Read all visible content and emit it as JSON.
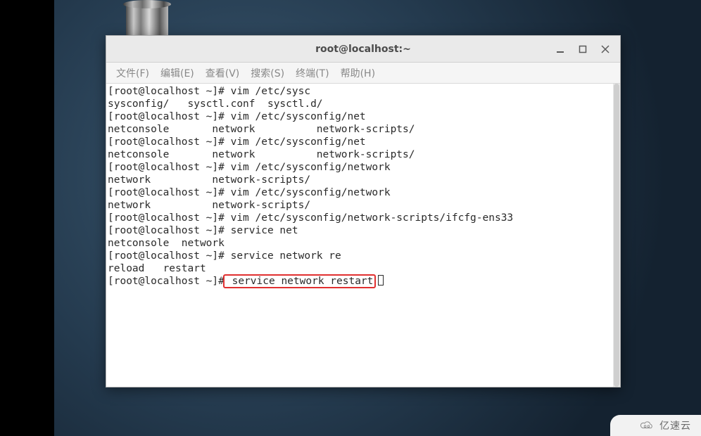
{
  "desktop": {
    "trash_label": "Trash"
  },
  "window": {
    "title": "root@localhost:~"
  },
  "menubar": {
    "items": [
      "文件(F)",
      "编辑(E)",
      "查看(V)",
      "搜索(S)",
      "终端(T)",
      "帮助(H)"
    ]
  },
  "terminal": {
    "lines": [
      "[root@localhost ~]# vim /etc/sysc",
      "sysconfig/   sysctl.conf  sysctl.d/",
      "[root@localhost ~]# vim /etc/sysconfig/net",
      "netconsole       network          network-scripts/",
      "[root@localhost ~]# vim /etc/sysconfig/net",
      "netconsole       network          network-scripts/",
      "[root@localhost ~]# vim /etc/sysconfig/network",
      "network          network-scripts/",
      "[root@localhost ~]# vim /etc/sysconfig/network",
      "network          network-scripts/",
      "[root@localhost ~]# vim /etc/sysconfig/network-scripts/ifcfg-ens33",
      "[root@localhost ~]# service net",
      "netconsole  network",
      "[root@localhost ~]# service network re",
      "reload   restart"
    ],
    "final_prompt": "[root@localhost ~]#",
    "highlight_cmd": " service network restart"
  },
  "watermark": {
    "text": "亿速云"
  }
}
